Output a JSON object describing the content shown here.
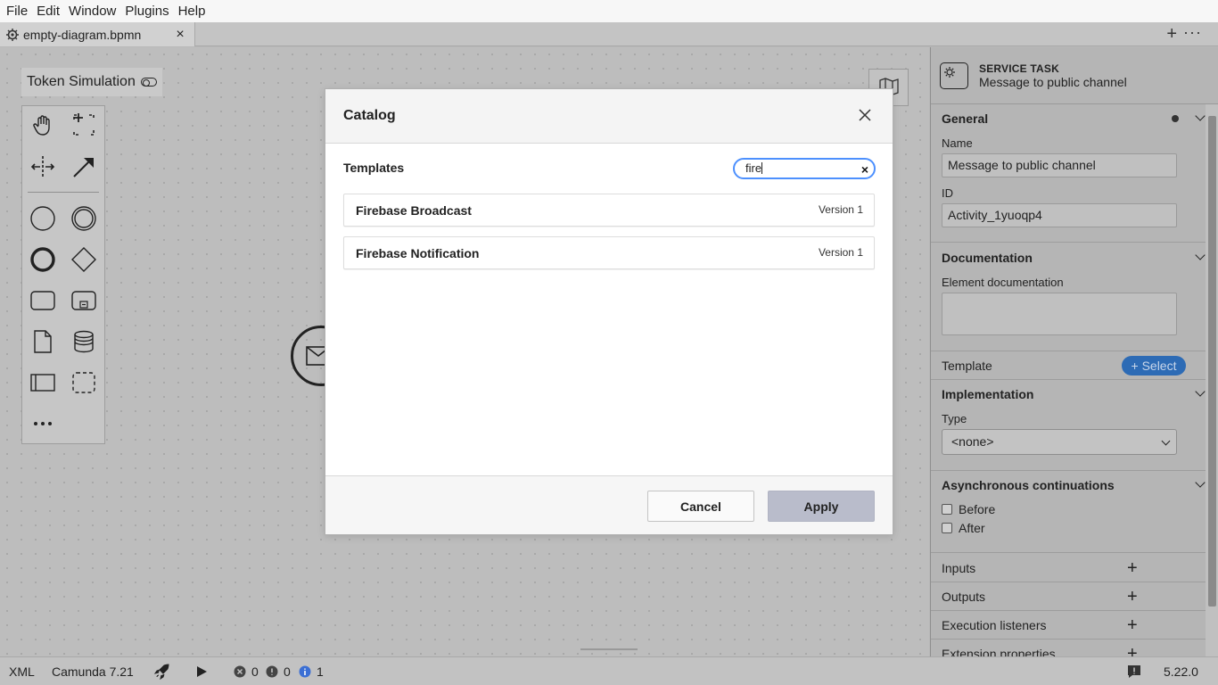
{
  "menubar": {
    "items": [
      "File",
      "Edit",
      "Window",
      "Plugins",
      "Help"
    ]
  },
  "tabs": {
    "active": {
      "label": "empty-diagram.bpmn",
      "close": "×"
    },
    "add": "+",
    "more": "···"
  },
  "canvas": {
    "token_simulation": "Token Simulation",
    "palette_tools": [
      "hand-tool-icon",
      "lasso-tool-icon",
      "space-tool-icon",
      "connect-tool-icon",
      "start-event-icon",
      "intermediate-event-icon",
      "end-event-icon",
      "gateway-icon",
      "task-icon",
      "subprocess-icon",
      "data-object-icon",
      "data-store-icon",
      "pool-icon",
      "group-icon",
      "more-icon"
    ]
  },
  "modal": {
    "title": "Catalog",
    "section_label": "Templates",
    "search": {
      "value": "fire",
      "clear": "×"
    },
    "templates": [
      {
        "name": "Firebase Broadcast",
        "version": "Version 1"
      },
      {
        "name": "Firebase Notification",
        "version": "Version 1"
      }
    ],
    "buttons": {
      "cancel": "Cancel",
      "apply": "Apply"
    }
  },
  "properties": {
    "header": {
      "type": "SERVICE TASK",
      "name": "Message to public channel"
    },
    "general": {
      "title": "General",
      "name_label": "Name",
      "name_value": "Message to public channel",
      "id_label": "ID",
      "id_value": "Activity_1yuoqp4"
    },
    "documentation": {
      "title": "Documentation",
      "label": "Element documentation",
      "value": ""
    },
    "template": {
      "title": "Template",
      "button": "+ Select"
    },
    "implementation": {
      "title": "Implementation",
      "type_label": "Type",
      "type_value": "<none>"
    },
    "async": {
      "title": "Asynchronous continuations",
      "before": "Before",
      "after": "After"
    },
    "inputs": "Inputs",
    "outputs": "Outputs",
    "execution_listeners": "Execution listeners",
    "extension_properties": "Extension properties"
  },
  "statusbar": {
    "xml": "XML",
    "engine": "Camunda 7.21",
    "errors": "0",
    "warnings": "0",
    "infos": "1",
    "version": "5.22.0"
  },
  "colors": {
    "accent": "#4d90fe",
    "select_button": "#2d6bb5",
    "info": "#3b6fd4"
  }
}
